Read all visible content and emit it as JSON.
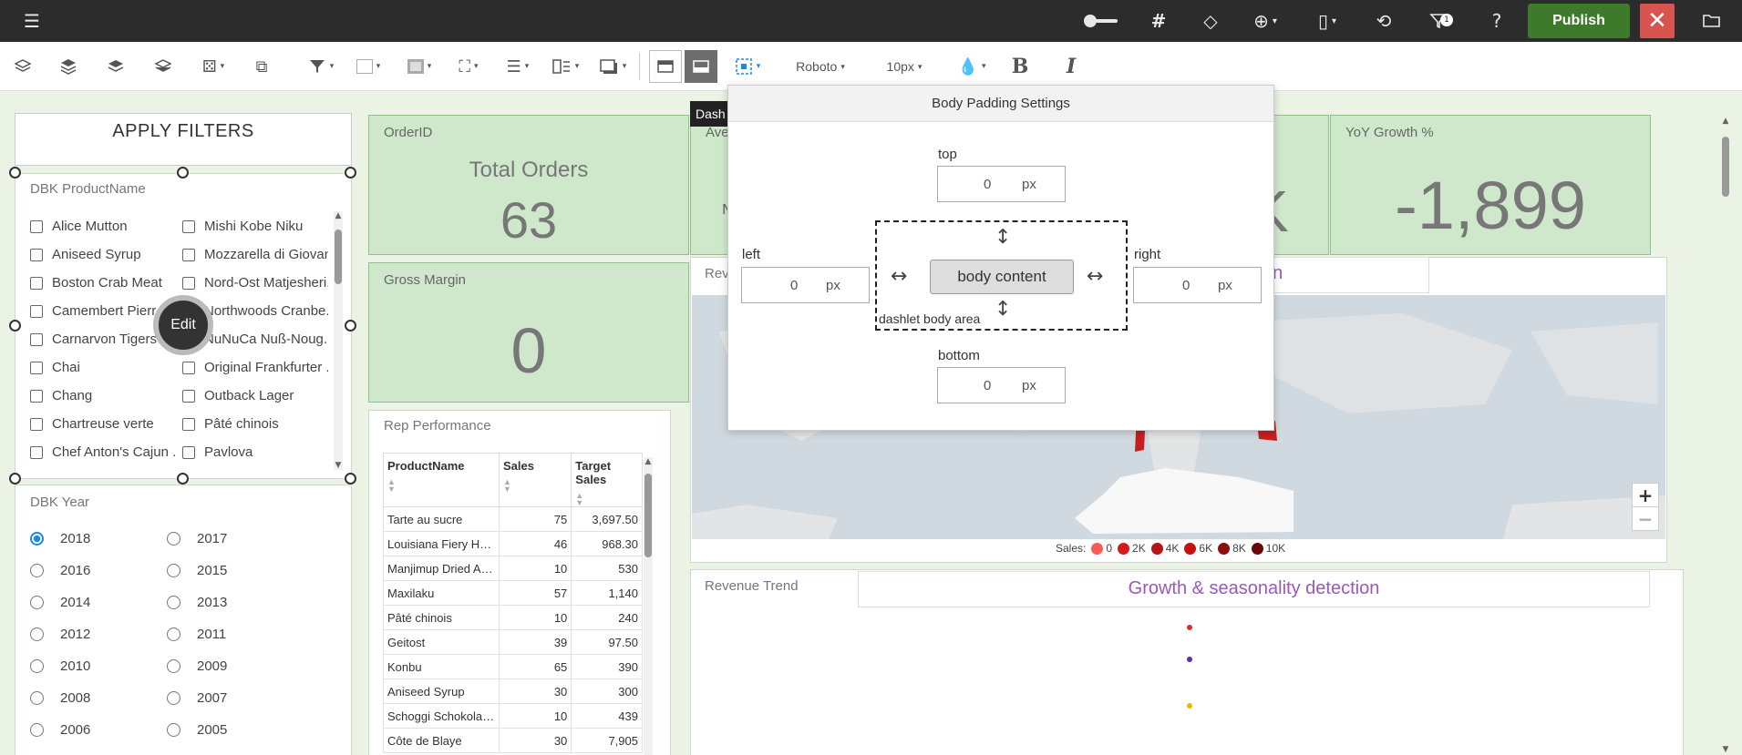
{
  "topbar": {
    "publish_label": "Publish",
    "filter_badge": "1"
  },
  "toolbar": {
    "font_name": "Roboto",
    "font_size": "10px"
  },
  "filters": {
    "apply_label": "APPLY FILTERS",
    "product_title": "DBK ProductName",
    "products_col1": [
      "Alice Mutton",
      "Aniseed Syrup",
      "Boston Crab Meat",
      "Camembert Pierr",
      "Carnarvon Tigers",
      "Chai",
      "Chang",
      "Chartreuse verte",
      "Chef Anton's Cajun ..."
    ],
    "products_col2": [
      "Mishi Kobe Niku",
      "Mozzarella di Giovan",
      "Nord-Ost Matjesheri..",
      "Northwoods Cranbe..",
      "NuNuCa Nuß-Noug..",
      "Original Frankfurter ..",
      "Outback Lager",
      "Pâté chinois",
      "Pavlova"
    ],
    "edit_label": "Edit",
    "year_title": "DBK Year",
    "years_col1": [
      "2018",
      "2016",
      "2014",
      "2012",
      "2010",
      "2008",
      "2006"
    ],
    "years_col2": [
      "2017",
      "2015",
      "2013",
      "2011",
      "2009",
      "2007",
      "2005"
    ],
    "selected_year": "2018"
  },
  "tooltip": {
    "text": "Dash"
  },
  "kpis": {
    "orders": {
      "label": "OrderID",
      "subtitle": "Total Orders",
      "value": "63"
    },
    "avg": {
      "label": "Ave",
      "sub_fragment": "N"
    },
    "k_fragment": "K",
    "yoy": {
      "label": "YoY Growth %",
      "value": "-1,899"
    },
    "margin": {
      "label": "Gross Margin",
      "value": "0"
    }
  },
  "rep": {
    "title": "Rep Performance",
    "columns": [
      "ProductName",
      "Sales",
      "Target Sales"
    ],
    "rows": [
      [
        "Tarte au sucre",
        "75",
        "3,697.50"
      ],
      [
        "Louisiana Fiery Hot...",
        "46",
        "968.30"
      ],
      [
        "Manjimup Dried Ap...",
        "10",
        "530"
      ],
      [
        "Maxilaku",
        "57",
        "1,140"
      ],
      [
        "Pâté chinois",
        "10",
        "240"
      ],
      [
        "Geitost",
        "39",
        "97.50"
      ],
      [
        "Konbu",
        "65",
        "390"
      ],
      [
        "Aniseed Syrup",
        "30",
        "300"
      ],
      [
        "Schoggi Schokolade",
        "10",
        "439"
      ],
      [
        "Côte de Blaye",
        "30",
        "7,905"
      ]
    ]
  },
  "map": {
    "title_fragment": "Rev",
    "header_fragment": "on",
    "legend_label": "Sales:",
    "legend": [
      {
        "label": "0",
        "color": "#ff5a5a"
      },
      {
        "label": "2K",
        "color": "#d61a1a"
      },
      {
        "label": "4K",
        "color": "#b51414"
      },
      {
        "label": "6K",
        "color": "#c41010"
      },
      {
        "label": "8K",
        "color": "#8a0e0e"
      },
      {
        "label": "10K",
        "color": "#6a0808"
      }
    ],
    "zoom_in": "+",
    "zoom_out": "−"
  },
  "trend": {
    "title": "Revenue Trend",
    "header": "Growth & seasonality detection",
    "header_color": "#9b59b6"
  },
  "popup": {
    "title": "Body Padding Settings",
    "top_label": "top",
    "left_label": "left",
    "right_label": "right",
    "bottom_label": "bottom",
    "top_value": "0",
    "left_value": "0",
    "right_value": "0",
    "bottom_value": "0",
    "unit": "px",
    "body_content_label": "body content",
    "area_label": "dashlet body area"
  }
}
